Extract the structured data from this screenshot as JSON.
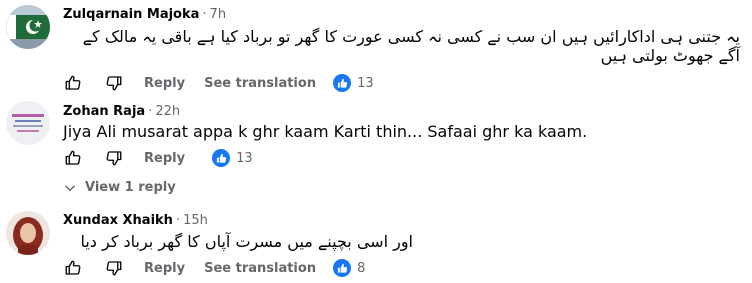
{
  "comments": [
    {
      "author": "Zulqarnain Majoka",
      "time": "7h",
      "text": "یہ جتنی ہی اداکارائیں ہیں ان سب نے کسی نہ کسی عورت کا گھر تو برباد کیا ہے باقی یہ مالک کے آگے جھوٹ بولتی ہیں",
      "reply_label": "Reply",
      "translate_label": "See translation",
      "like_count": "13",
      "avatar_icon": "pakistan-flag-avatar"
    },
    {
      "author": "Zohan Raja",
      "time": "22h",
      "text": "Jiya Ali musarat appa k ghr kaam Karti thin... Safaai ghr ka kaam.",
      "reply_label": "Reply",
      "like_count": "13",
      "view_replies_label": "View 1 reply",
      "avatar_icon": "text-graphic-avatar"
    },
    {
      "author": "Xundax Xhaikh",
      "time": "15h",
      "text": "اور اسی بچپنے میں مسرت آپاں کا گھر برباد کر دیا",
      "reply_label": "Reply",
      "translate_label": "See translation",
      "like_count": "8",
      "avatar_icon": "portrait-avatar"
    }
  ],
  "colors": {
    "text": "#050505",
    "muted": "#65676b",
    "like_blue": "#1877f2"
  }
}
